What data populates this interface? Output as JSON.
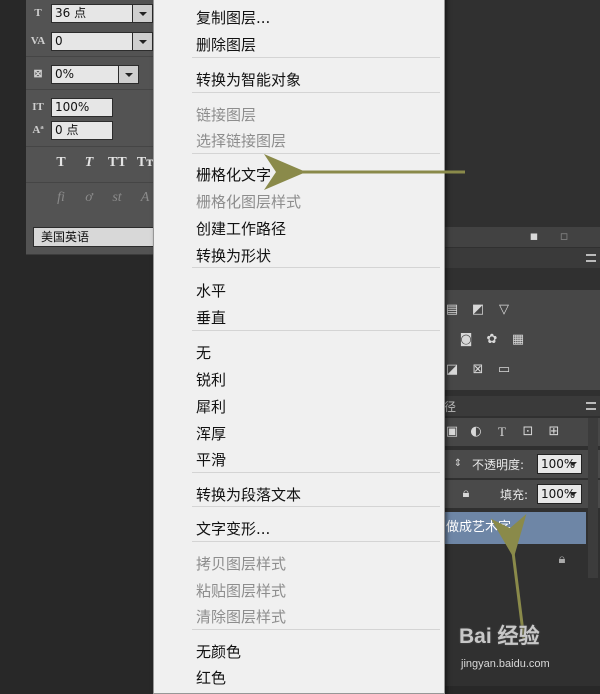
{
  "character_panel": {
    "font_size": "36 点",
    "tracking": "0",
    "vertical_scale": "0%",
    "horizontal_scale": "100%",
    "baseline_shift": "0 点",
    "style_buttons": [
      "T",
      "T",
      "TT",
      "Tт"
    ],
    "opentype_buttons": [
      "fi",
      "ơ",
      "st",
      "A"
    ],
    "language": "美国英语"
  },
  "context_menu": {
    "items": [
      {
        "label": "复制图层...",
        "disabled": false
      },
      {
        "label": "删除图层",
        "disabled": false
      },
      {
        "label": "转换为智能对象",
        "disabled": false
      },
      {
        "label": "链接图层",
        "disabled": true
      },
      {
        "label": "选择链接图层",
        "disabled": true
      },
      {
        "label": "栅格化文字",
        "disabled": false
      },
      {
        "label": "栅格化图层样式",
        "disabled": true
      },
      {
        "label": "创建工作路径",
        "disabled": false
      },
      {
        "label": "转换为形状",
        "disabled": false
      },
      {
        "label": "水平",
        "disabled": false
      },
      {
        "label": "垂直",
        "disabled": false
      },
      {
        "label": "无",
        "disabled": false
      },
      {
        "label": "锐利",
        "disabled": false
      },
      {
        "label": "犀利",
        "disabled": false
      },
      {
        "label": "浑厚",
        "disabled": false
      },
      {
        "label": "平滑",
        "disabled": false
      },
      {
        "label": "转换为段落文本",
        "disabled": false
      },
      {
        "label": "文字变形...",
        "disabled": false
      },
      {
        "label": "拷贝图层样式",
        "disabled": true
      },
      {
        "label": "粘贴图层样式",
        "disabled": true
      },
      {
        "label": "清除图层样式",
        "disabled": true
      },
      {
        "label": "无颜色",
        "disabled": false
      },
      {
        "label": "红色",
        "disabled": false
      }
    ]
  },
  "layers_panel": {
    "tab_fragment": "径",
    "opacity_label": "不透明度:",
    "opacity_value": "100%",
    "fill_label": "填充:",
    "fill_value": "100%",
    "layer_name": "做成艺术字"
  },
  "watermark": {
    "logo": "Bai 经验",
    "url": "jingyan.baidu.com"
  },
  "colors": {
    "menu_bg": "#f0f0f0",
    "panel_bg": "#535353",
    "dark_bg": "#282828",
    "selected_layer": "#6e86a6",
    "arrow": "#8a8a4a"
  }
}
